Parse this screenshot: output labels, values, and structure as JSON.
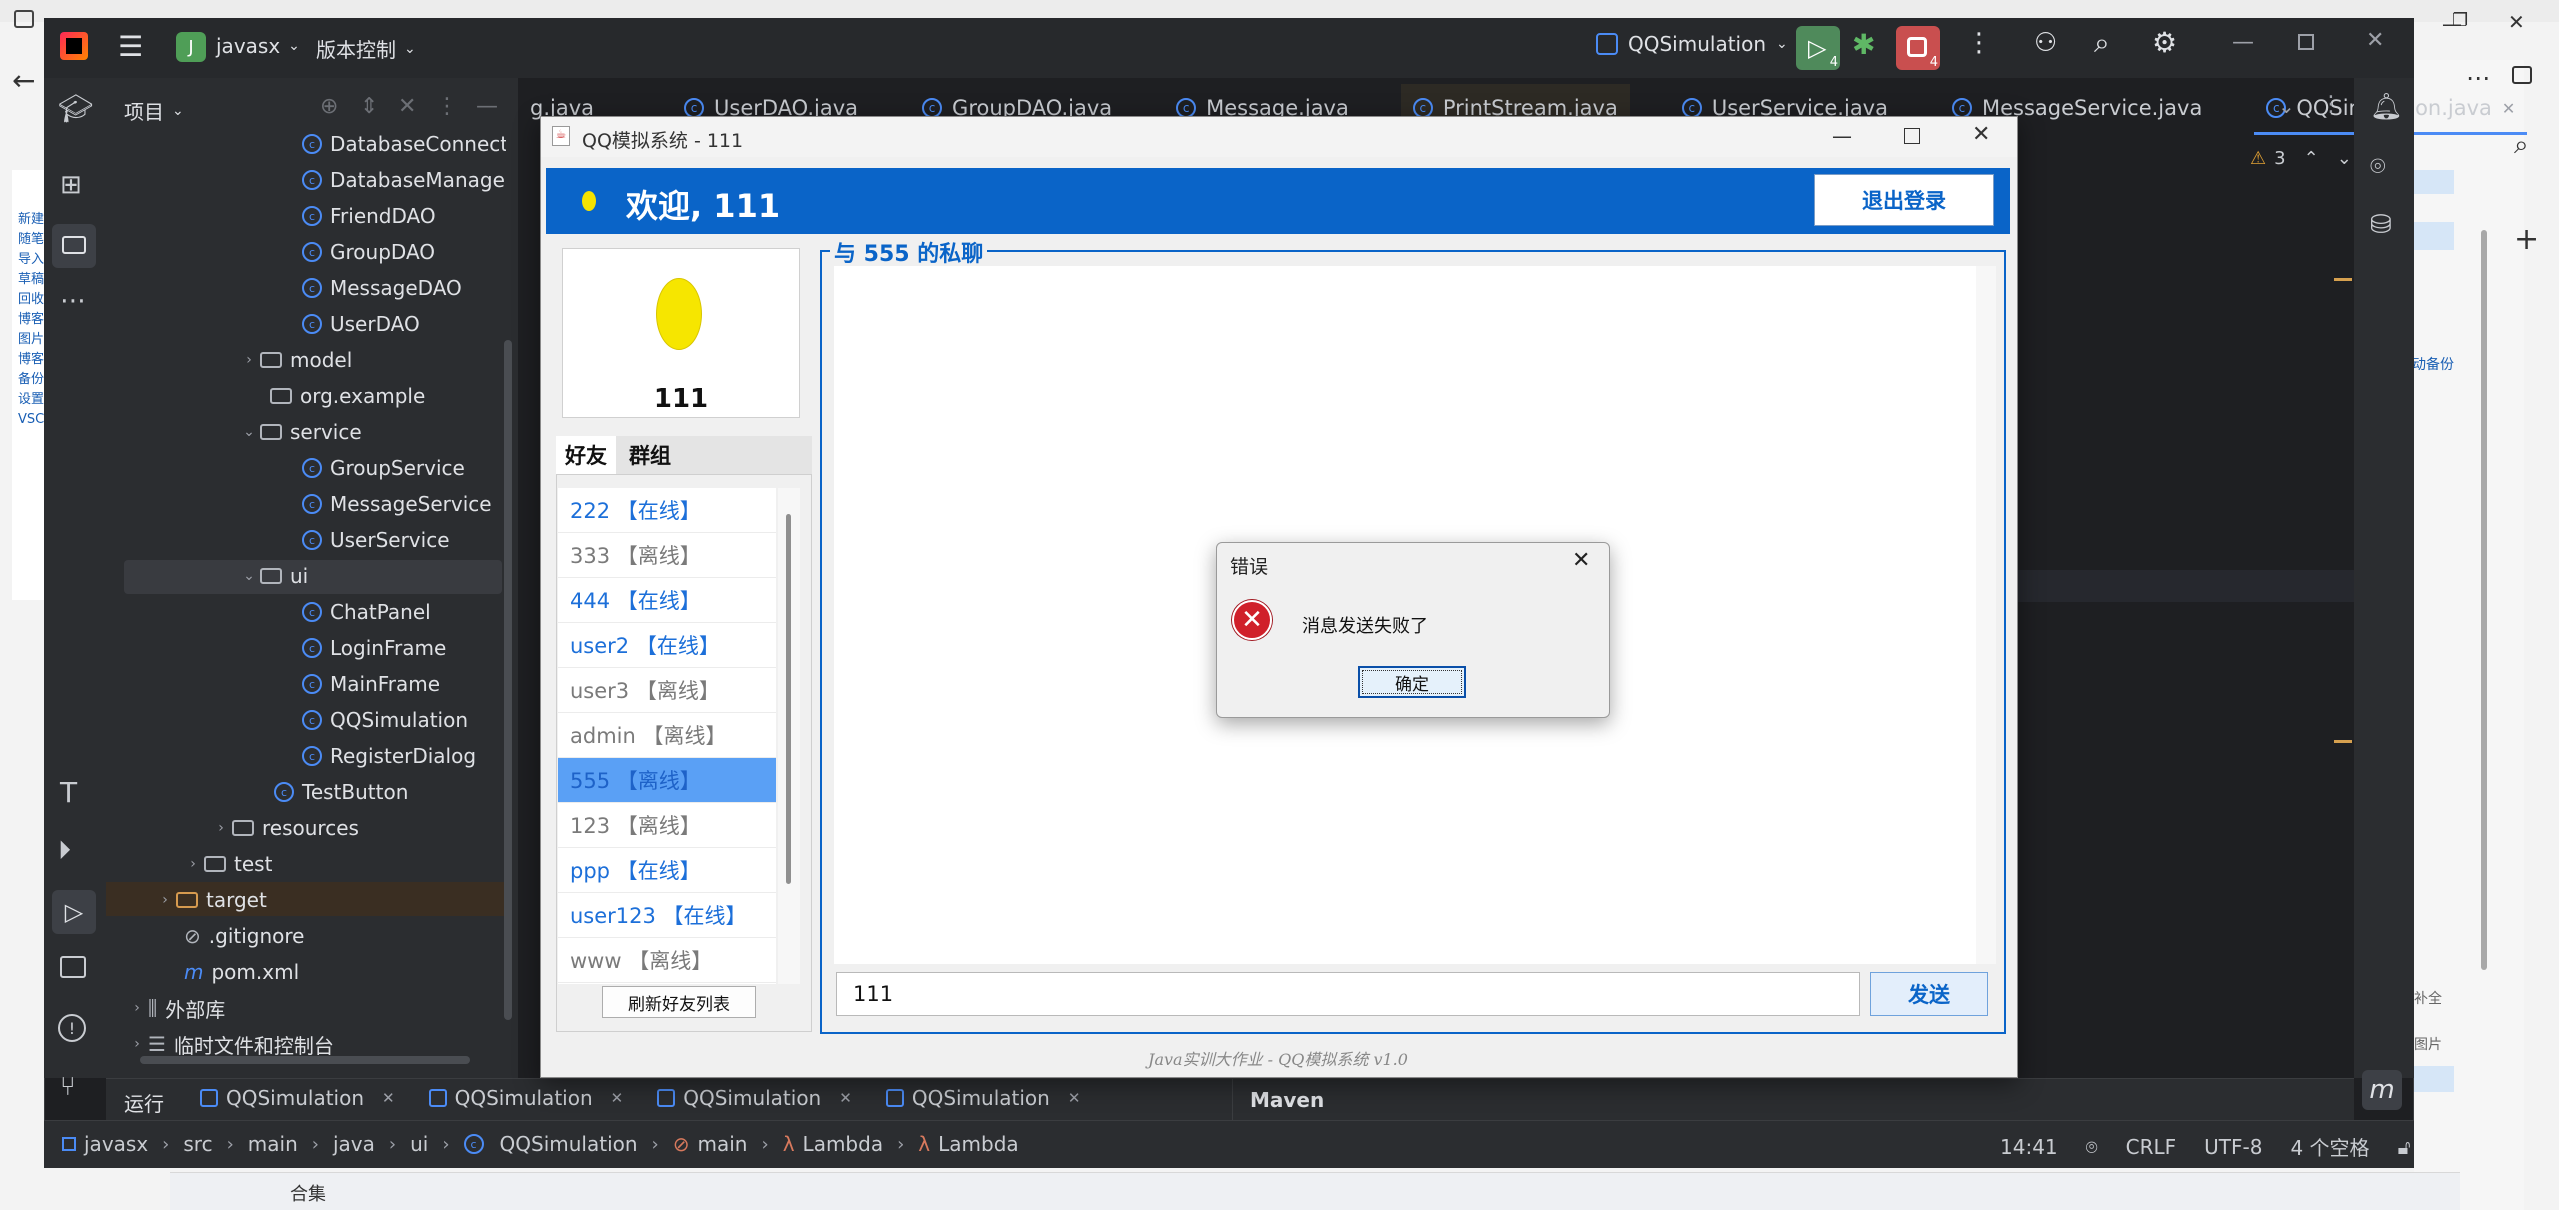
{
  "ide": {
    "project_initial": "J",
    "project_name": "javasx",
    "vcs_label": "版本控制",
    "run_config": "QQSimulation",
    "run_badge": "4",
    "stop_badge": "4",
    "project_panel_label": "项目",
    "editor_tabs": [
      {
        "label": "g.java"
      },
      {
        "label": "UserDAO.java"
      },
      {
        "label": "GroupDAO.java"
      },
      {
        "label": "Message.java"
      },
      {
        "label": "PrintStream.java"
      },
      {
        "label": "UserService.java"
      },
      {
        "label": "MessageService.java"
      },
      {
        "label": "QQSimulation.java"
      }
    ],
    "warnings_count": "3",
    "tree": [
      {
        "label": "DatabaseConnection",
        "type": "class"
      },
      {
        "label": "DatabaseManager",
        "type": "class"
      },
      {
        "label": "FriendDAO",
        "type": "class"
      },
      {
        "label": "GroupDAO",
        "type": "class"
      },
      {
        "label": "MessageDAO",
        "type": "class"
      },
      {
        "label": "UserDAO",
        "type": "class"
      },
      {
        "label": "model",
        "type": "package"
      },
      {
        "label": "org.example",
        "type": "package"
      },
      {
        "label": "service",
        "type": "package"
      },
      {
        "label": "GroupService",
        "type": "class"
      },
      {
        "label": "MessageService",
        "type": "class"
      },
      {
        "label": "UserService",
        "type": "class"
      },
      {
        "label": "ui",
        "type": "package"
      },
      {
        "label": "ChatPanel",
        "type": "class"
      },
      {
        "label": "LoginFrame",
        "type": "class"
      },
      {
        "label": "MainFrame",
        "type": "class"
      },
      {
        "label": "QQSimulation",
        "type": "class"
      },
      {
        "label": "RegisterDialog",
        "type": "class"
      },
      {
        "label": "TestButton",
        "type": "class"
      },
      {
        "label": "resources",
        "type": "folder"
      },
      {
        "label": "test",
        "type": "folder"
      },
      {
        "label": "target",
        "type": "folder"
      },
      {
        "label": ".gitignore",
        "type": "file"
      },
      {
        "label": "pom.xml",
        "type": "file"
      },
      {
        "label": "外部库",
        "type": "lib"
      },
      {
        "label": "临时文件和控制台",
        "type": "lib"
      }
    ],
    "run_panel_label": "运行",
    "run_tabs": [
      "QQSimulation",
      "QQSimulation",
      "QQSimulation",
      "QQSimulation"
    ],
    "maven_label": "Maven",
    "breadcrumb": [
      "javasx",
      "src",
      "main",
      "java",
      "ui",
      "QQSimulation",
      "main",
      "Lambda",
      "Lambda"
    ],
    "status": {
      "position": "14:41",
      "line_sep": "CRLF",
      "encoding": "UTF-8",
      "indent": "4 个空格"
    },
    "bottom_strip_label": "合集"
  },
  "app": {
    "window_title": "QQ模拟系统 - 111",
    "welcome": "欢迎, 111",
    "logout_label": "退出登录",
    "avatar_name": "111",
    "tab_friends": "好友",
    "tab_groups": "群组",
    "friends": [
      {
        "label": "222 【在线】",
        "status": "online"
      },
      {
        "label": "333 【离线】",
        "status": "offline"
      },
      {
        "label": "444 【在线】",
        "status": "online"
      },
      {
        "label": "user2 【在线】",
        "status": "online"
      },
      {
        "label": "user3 【离线】",
        "status": "offline"
      },
      {
        "label": "admin 【离线】",
        "status": "offline"
      },
      {
        "label": "555 【离线】",
        "status": "selected"
      },
      {
        "label": "123 【离线】",
        "status": "offline"
      },
      {
        "label": "ppp 【在线】",
        "status": "online"
      },
      {
        "label": "user123 【在线】",
        "status": "online"
      },
      {
        "label": "www 【离线】",
        "status": "offline"
      }
    ],
    "refresh_label": "刷新好友列表",
    "chat_title": "与 555 的私聊",
    "message_input": "111",
    "send_label": "发送",
    "footer": "Java实训大作业 - QQ模拟系统 v1.0"
  },
  "dialog": {
    "title": "错误",
    "message": "消息发送失败了",
    "ok_label": "确定"
  },
  "browser_sidebar": [
    "新建",
    "随笔",
    "导入",
    "草稿",
    "回收",
    "博客",
    "图片",
    "博客",
    "备份",
    "设置",
    "VSC"
  ],
  "browser_right": {
    "backup": "动备份",
    "all": "补全",
    "image": "图片"
  },
  "colors": {
    "ide_bg": "#1e1f22",
    "ide_panel": "#2b2d30",
    "accent_blue": "#0a64c8",
    "online": "#1c6fd9",
    "selected": "#5aa0f5",
    "error_red": "#d0202a"
  }
}
